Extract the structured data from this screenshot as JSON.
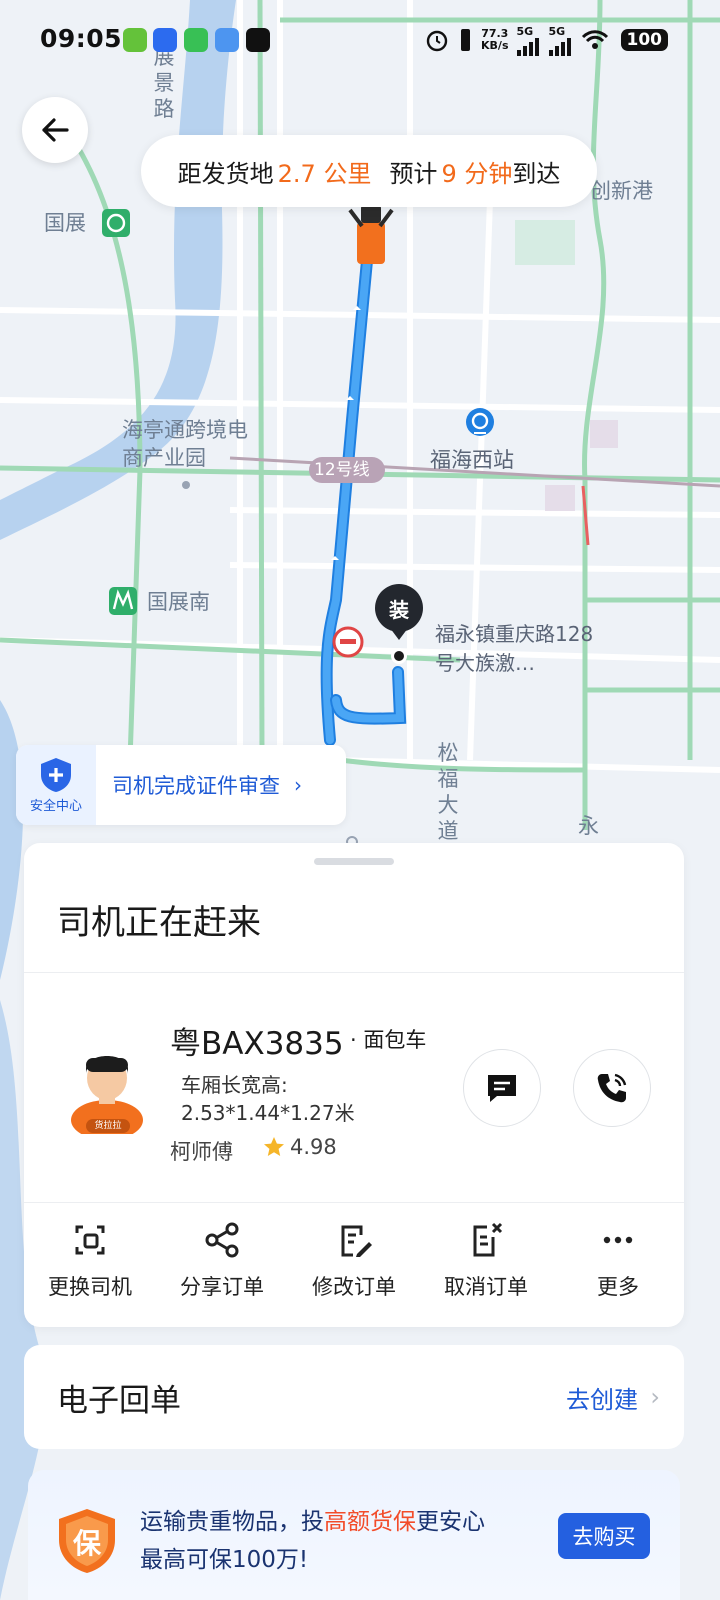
{
  "status_bar": {
    "time": "09:05",
    "net_speed_value": "77.3",
    "net_speed_unit": "KB/s",
    "signal1": "5G",
    "signal2": "5G",
    "battery": "100"
  },
  "eta": {
    "prefix": "距发货地",
    "distance": "2.7 公里",
    "mid": "预计",
    "minutes": "9 分钟",
    "suffix": "到达"
  },
  "map": {
    "labels": {
      "zhanjing": "展景路",
      "guozhan": "国展",
      "chuangxin": "创新港",
      "haiting": "海亭通跨境电商产业园",
      "fuhai_station": "福海西站",
      "line12": "12号线",
      "guozhan_south": "国展南",
      "destination": "福永镇重庆路128号大族激…",
      "songfu": "松福大道",
      "yong": "永"
    },
    "load_marker": "装"
  },
  "safety": {
    "icon_label": "安全中心",
    "text": "司机完成证件审查",
    "arrow": "›"
  },
  "driver_card": {
    "status": "司机正在赶来",
    "plate": "粤BAX3835",
    "vehicle_type": "· 面包车",
    "dims_label": "车厢长宽高:",
    "dims_value": "2.53*1.44*1.27米",
    "driver_name": "柯师傅",
    "rating": "4.98",
    "avatar_badge": "货拉拉",
    "actions": [
      {
        "label": "更换司机",
        "icon": "swap-driver-icon"
      },
      {
        "label": "分享订单",
        "icon": "share-icon"
      },
      {
        "label": "修改订单",
        "icon": "edit-order-icon"
      },
      {
        "label": "取消订单",
        "icon": "cancel-order-icon"
      },
      {
        "label": "更多",
        "icon": "more-icon"
      }
    ]
  },
  "receipt": {
    "title": "电子回单",
    "link": "去创建",
    "chevron": "›"
  },
  "insurance": {
    "icon_text": "保",
    "line1_a": "运输贵重物品，投",
    "line1_highlight": "高额货保",
    "line1_b": "更安心",
    "line2": "最高可保100万!",
    "button": "去购买"
  },
  "colors": {
    "accent_orange": "#f26a1b",
    "accent_blue": "#2460e0",
    "route_blue": "#3c96f0"
  }
}
